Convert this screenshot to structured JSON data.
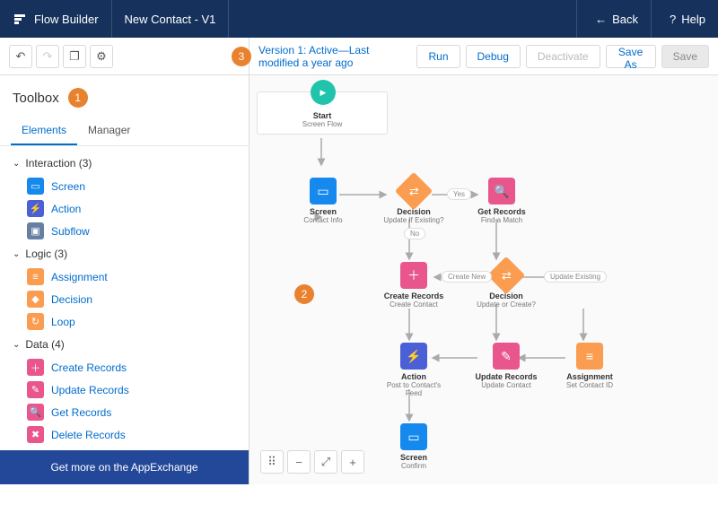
{
  "header": {
    "app": "Flow Builder",
    "flow_name": "New Contact - V1",
    "back": "Back",
    "help": "Help"
  },
  "toolbar": {
    "version_text": "Version 1: Active—Last modified a year ago",
    "run": "Run",
    "debug": "Debug",
    "deactivate": "Deactivate",
    "save_as": "Save As",
    "save": "Save"
  },
  "sidebar": {
    "title": "Toolbox",
    "tabs": {
      "elements": "Elements",
      "manager": "Manager"
    },
    "groups": [
      {
        "label": "Interaction (3)",
        "items": [
          {
            "color": "c-blue",
            "label": "Screen"
          },
          {
            "color": "c-indigo",
            "label": "Action"
          },
          {
            "color": "c-slate",
            "label": "Subflow"
          }
        ]
      },
      {
        "label": "Logic (3)",
        "items": [
          {
            "color": "c-orange",
            "label": "Assignment"
          },
          {
            "color": "c-orange",
            "label": "Decision"
          },
          {
            "color": "c-orange",
            "label": "Loop"
          }
        ]
      },
      {
        "label": "Data (4)",
        "items": [
          {
            "color": "c-pink",
            "label": "Create Records"
          },
          {
            "color": "c-pink",
            "label": "Update Records"
          },
          {
            "color": "c-pink",
            "label": "Get Records"
          },
          {
            "color": "c-pink",
            "label": "Delete Records"
          }
        ]
      }
    ],
    "footer": "Get more on the AppExchange"
  },
  "canvas": {
    "start": {
      "title": "Start",
      "sub": "Screen Flow"
    },
    "nodes": {
      "screen1": {
        "title": "Screen",
        "sub": "Contact Info"
      },
      "decision1": {
        "title": "Decision",
        "sub": "Update If Existing?"
      },
      "getrec": {
        "title": "Get Records",
        "sub": "Find a Match"
      },
      "createrec": {
        "title": "Create Records",
        "sub": "Create Contact"
      },
      "decision2": {
        "title": "Decision",
        "sub": "Update or Create?"
      },
      "action": {
        "title": "Action",
        "sub": "Post to Contact's Feed"
      },
      "updaterec": {
        "title": "Update Records",
        "sub": "Update Contact"
      },
      "assign": {
        "title": "Assignment",
        "sub": "Set Contact ID"
      },
      "screen2": {
        "title": "Screen",
        "sub": "Confirm"
      }
    },
    "labels": {
      "yes": "Yes",
      "no": "No",
      "create_new": "Create New",
      "update_existing": "Update Existing"
    }
  },
  "badges": {
    "one": "1",
    "two": "2",
    "three": "3"
  }
}
